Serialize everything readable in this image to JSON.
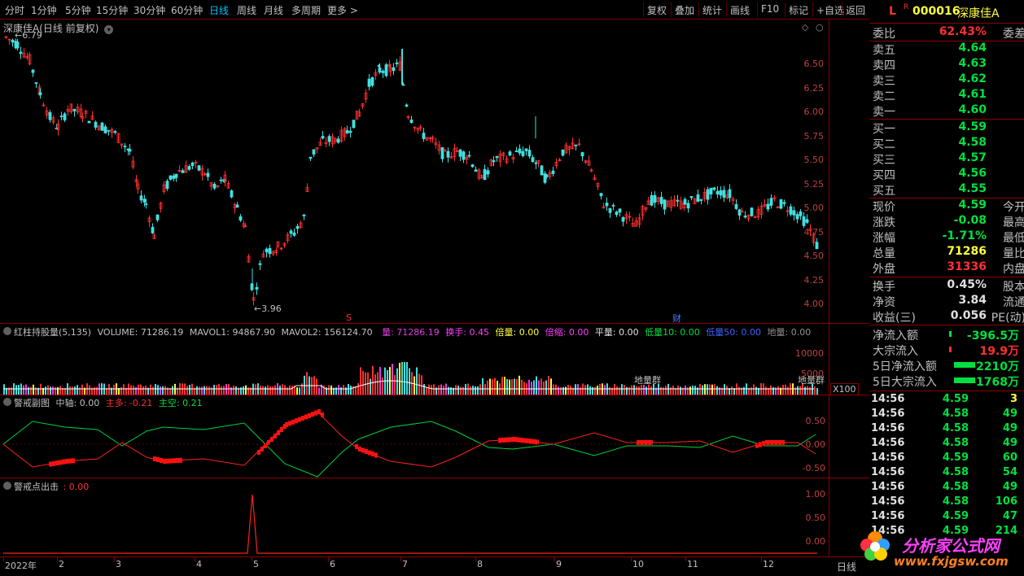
{
  "toolbar": {
    "periods": [
      "分时",
      "1分钟",
      "5分钟",
      "15分钟",
      "30分钟",
      "60分钟",
      "日线",
      "周线",
      "月线",
      "多周期",
      "更多 >"
    ],
    "active": 6,
    "buttons": [
      "复权",
      "叠加",
      "统计",
      "画线",
      "F10",
      "标记",
      "+自选",
      "返回"
    ]
  },
  "chart": {
    "title": "深康佳A",
    "subtitle": "(日线 前复权)",
    "high_label": "6.79",
    "low_label": "3.96",
    "yticks": [
      "6.50",
      "6.25",
      "6.00",
      "5.75",
      "5.50",
      "5.25",
      "5.00",
      "4.75",
      "4.50",
      "4.25",
      "4.00"
    ],
    "marker_s": "S",
    "marker_cai": "财"
  },
  "volume": {
    "title": "红柱持股量(5,135)",
    "vol": "VOLUME: 71286.19",
    "ma1": "MAVOL1: 94867.90",
    "ma2": "MAVOL2: 156124.70",
    "liang": "量: 71286.19",
    "huanshou": "换手: 0.45",
    "beiliang": "倍量: 0.00",
    "beisuo": "倍缩: 0.00",
    "pingliang": "平量: 0.00",
    "diliang10": "低量10: 0.00",
    "diliang50": "低量50: 0.00",
    "diliang": "地量: 0.00",
    "yticks": [
      "10000",
      "5000"
    ],
    "unit": "X100",
    "dlq1": "地量群",
    "dlq2": "地量群"
  },
  "sub1": {
    "title": "警戒副图",
    "zhongzhou": "中轴: 0.00",
    "zhuduo": "主多: -0.21",
    "zhukong": "主空: 0.21",
    "yticks": [
      "0.50",
      "0.00",
      "-0.50"
    ]
  },
  "sub2": {
    "title": "警戒点出击",
    "val": ": 0.00",
    "yticks": [
      "1.00",
      "0.50",
      "0.00"
    ]
  },
  "xaxis": {
    "labels": [
      "2022年",
      "2",
      "3",
      "4",
      "5",
      "6",
      "7",
      "8",
      "9",
      "10",
      "11",
      "12"
    ],
    "right": "日线"
  },
  "quote": {
    "flag": "L",
    "r": "R",
    "code": "000016",
    "name": "深康佳A",
    "weibi_lab": "委比",
    "weibi": "62.43%",
    "weicha_lab": "委差",
    "asks": [
      {
        "l": "卖五",
        "p": "4.64"
      },
      {
        "l": "卖四",
        "p": "4.63"
      },
      {
        "l": "卖三",
        "p": "4.62"
      },
      {
        "l": "卖二",
        "p": "4.61"
      },
      {
        "l": "卖一",
        "p": "4.60"
      }
    ],
    "bids": [
      {
        "l": "买一",
        "p": "4.59"
      },
      {
        "l": "买二",
        "p": "4.58"
      },
      {
        "l": "买三",
        "p": "4.57"
      },
      {
        "l": "买四",
        "p": "4.56"
      },
      {
        "l": "买五",
        "p": "4.55"
      }
    ],
    "stats": [
      {
        "l": "现价",
        "v": "4.59",
        "c": "g",
        "l2": "今开"
      },
      {
        "l": "涨跌",
        "v": "-0.08",
        "c": "g",
        "l2": "最高"
      },
      {
        "l": "涨幅",
        "v": "-1.71%",
        "c": "g",
        "l2": "最低"
      },
      {
        "l": "总量",
        "v": "71286",
        "c": "y",
        "l2": "量比"
      },
      {
        "l": "外盘",
        "v": "31336",
        "c": "r",
        "l2": "内盘"
      }
    ],
    "stats2": [
      {
        "l": "换手",
        "v": "0.45%",
        "c": "w",
        "l2": "股本"
      },
      {
        "l": "净资",
        "v": "3.84",
        "c": "w",
        "l2": "流通"
      },
      {
        "l": "收益(三)",
        "v": "0.056",
        "c": "w",
        "l2": "PE(动)"
      }
    ],
    "flows": [
      {
        "l": "净流入额",
        "v": "-396.5万",
        "c": "g"
      },
      {
        "l": "大宗流入",
        "v": "19.9万",
        "c": "r"
      },
      {
        "l": "5日净流入额",
        "v": "-2210万",
        "c": "g"
      },
      {
        "l": "5日大宗流入",
        "v": "-1768万",
        "c": "g"
      }
    ],
    "ticks": [
      {
        "t": "14:56",
        "p": "4.59",
        "v": "3",
        "pc": "g",
        "vc": "y"
      },
      {
        "t": "14:56",
        "p": "4.58",
        "v": "49",
        "pc": "g",
        "vc": "g"
      },
      {
        "t": "14:56",
        "p": "4.58",
        "v": "49",
        "pc": "g",
        "vc": "g"
      },
      {
        "t": "14:56",
        "p": "4.58",
        "v": "49",
        "pc": "g",
        "vc": "g"
      },
      {
        "t": "14:56",
        "p": "4.59",
        "v": "60",
        "pc": "g",
        "vc": "g"
      },
      {
        "t": "14:56",
        "p": "4.58",
        "v": "54",
        "pc": "g",
        "vc": "g"
      },
      {
        "t": "14:56",
        "p": "4.58",
        "v": "49",
        "pc": "g",
        "vc": "g"
      },
      {
        "t": "14:56",
        "p": "4.58",
        "v": "106",
        "pc": "g",
        "vc": "g"
      },
      {
        "t": "14:56",
        "p": "4.59",
        "v": "47",
        "pc": "g",
        "vc": "g"
      },
      {
        "t": "14:56",
        "p": "4.59",
        "v": "214",
        "pc": "g",
        "vc": "g"
      }
    ]
  },
  "watermark": {
    "cn": "分析家公式网",
    "url": "www.fxjgsw.com"
  }
}
